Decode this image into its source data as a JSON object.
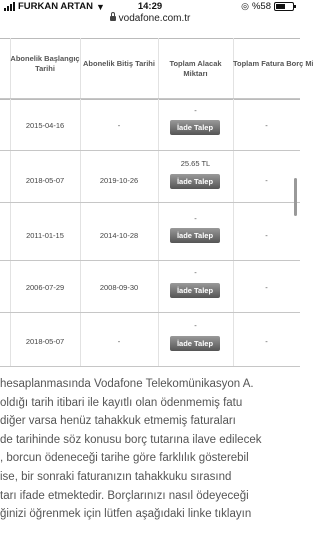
{
  "status_bar": {
    "carrier": "FURKAN ARTAN",
    "time": "14:29",
    "battery": "%58",
    "battery_level": 0.58,
    "url": "vodafone.com.tr"
  },
  "table": {
    "headers": {
      "start_date": "Abonelik Başlangıç Tarihi",
      "end_date": "Abonelik Bitiş Tarihi",
      "receivable": "Toplam Alacak Miktarı",
      "debt": "Toplam Fatura Borç Miktarı"
    },
    "refund_label": "İade Talep",
    "rows": [
      {
        "start": "2015-04-16",
        "end": "-",
        "amount": "-",
        "debt": "-"
      },
      {
        "start": "2018-05-07",
        "end": "2019-10-26",
        "amount": "25.65 TL",
        "debt": "-"
      },
      {
        "start": "2011-01-15",
        "end": "2014-10-28",
        "amount": "-",
        "debt": "-"
      },
      {
        "start": "2006-07-29",
        "end": "2008-09-30",
        "amount": "-",
        "debt": "-"
      },
      {
        "start": "2018-05-07",
        "end": "-",
        "amount": "-",
        "debt": "-"
      }
    ]
  },
  "paragraph": [
    "hesaplanmasında Vodafone Telekomünikasyon A.",
    "oldığı tarih itibari ile kayıtlı olan ödenmemiş fatu",
    "diğer varsa henüz tahakkuk etmemiş faturaları",
    "de tarihinde söz konusu borç tutarına ilave edilecek",
    ", borcun ödeneceği tarihe göre farklılık gösterebil",
    "ise, bir sonraki faturanızın tahakkuku sırasınd",
    "tarı ifade etmektedir. Borçlarınızı nasıl ödeyeceği",
    "ğinizi öğrenmek için lütfen aşağıdaki linke tıklayın"
  ]
}
